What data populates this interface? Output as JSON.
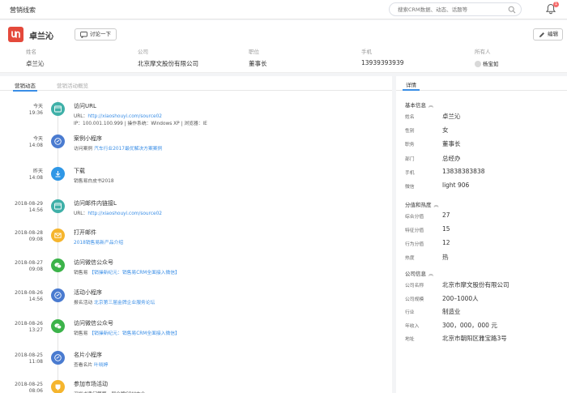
{
  "page_title": "营销线索",
  "search": {
    "placeholder": "搜索CRM数据、动态、话题等"
  },
  "notifications": {
    "count": "1"
  },
  "lead": {
    "name": "卓兰沁",
    "discuss_label": "讨论一下",
    "edit_label": "编辑",
    "fields": [
      {
        "label": "姓名",
        "value": "卓兰沁"
      },
      {
        "label": "公司",
        "value": "北京摩文股份有限公司"
      },
      {
        "label": "职位",
        "value": "董事长"
      },
      {
        "label": "手机",
        "value": "13939393939"
      },
      {
        "label": "所有人",
        "value": "杨宝如"
      }
    ]
  },
  "tabs": [
    {
      "label": "营销动态"
    },
    {
      "label": "营销活动概览"
    }
  ],
  "timeline": [
    {
      "date1": "今天",
      "date2": "19:36",
      "icon": "web-icon",
      "color": "#3fb0a8",
      "title": "访问URL",
      "l1_prefix": "URL：",
      "l1_link": "http://xiaoshouyi.com/source02",
      "l1_suffix": "",
      "l2": "IP：100.001.100.999 | 操作系统：Windows XP | 浏览器：IE"
    },
    {
      "date1": "今天",
      "date2": "14:08",
      "icon": "mini-program-icon",
      "color": "#4a7bd0",
      "title": "案例小程序",
      "l1_prefix": "访问案例 ",
      "l1_link": "汽车行业2017最优解决方案案例",
      "l1_suffix": "",
      "l2": ""
    },
    {
      "date1": "昨天",
      "date2": "14:08",
      "icon": "download-icon",
      "color": "#2f97e6",
      "title": "下载",
      "l1_prefix": "销售易白皮书2018",
      "l1_link": "",
      "l1_suffix": "",
      "l2": ""
    },
    {
      "date1": "2018-08-29",
      "date2": "14:56",
      "icon": "web-icon",
      "color": "#3fb0a8",
      "title": "访问邮件内链接L",
      "l1_prefix": "URL：",
      "l1_link": "http://xiaoshouyi.com/source02",
      "l1_suffix": "",
      "l2": ""
    },
    {
      "date1": "2018-08-28",
      "date2": "09:08",
      "icon": "mail-icon",
      "color": "#f5b52e",
      "title": "打开邮件",
      "l1_prefix": "",
      "l1_link": "2018销售易新产品介绍",
      "l1_suffix": "",
      "l2": ""
    },
    {
      "date1": "2018-08-27",
      "date2": "09:08",
      "icon": "wechat-icon",
      "color": "#3cb34a",
      "title": "访问微信公众号",
      "l1_prefix": "销售易 ",
      "l1_link": "【销操新纪元：销售易CRM全面接入微信】",
      "l1_suffix": "",
      "l2": ""
    },
    {
      "date1": "2018-08-26",
      "date2": "14:56",
      "icon": "mini-program-icon",
      "color": "#4a7bd0",
      "title": "活动小程序",
      "l1_prefix": "报名活动 ",
      "l1_link": "北京第三届金牌企业服务论坛",
      "l1_suffix": "",
      "l2": ""
    },
    {
      "date1": "2018-08-26",
      "date2": "13:27",
      "icon": "wechat-icon",
      "color": "#3cb34a",
      "title": "访问微信公众号",
      "l1_prefix": "销售易 ",
      "l1_link": "【销操新纪元：销售易CRM全面接入微信】",
      "l1_suffix": "",
      "l2": ""
    },
    {
      "date1": "2018-08-25",
      "date2": "11:08",
      "icon": "mini-program-icon",
      "color": "#4a7bd0",
      "title": "名片小程序",
      "l1_prefix": "查看名片 ",
      "l1_link": "叶晓婷",
      "l1_suffix": "",
      "l2": ""
    },
    {
      "date1": "2018-08-25",
      "date2": "08:06",
      "icon": "activity-icon",
      "color": "#f5b52e",
      "title": "参加市场活动",
      "l1_prefix": "深圳书香门第第一届金牌CRM大会",
      "l1_link": "",
      "l1_suffix": "",
      "l2": ""
    }
  ],
  "detail": {
    "tab_label": "详情",
    "sections": [
      {
        "title": "基本信息",
        "rows": [
          {
            "k": "姓名",
            "v": "卓兰沁"
          },
          {
            "k": "性别",
            "v": "女"
          },
          {
            "k": "职务",
            "v": "董事长"
          },
          {
            "k": "部门",
            "v": "总经办"
          },
          {
            "k": "手机",
            "v": "13838383838"
          },
          {
            "k": "微信",
            "v": "light 906"
          }
        ]
      },
      {
        "title": "分值和热度",
        "rows": [
          {
            "k": "综合分值",
            "v": "27"
          },
          {
            "k": "特征分值",
            "v": "15"
          },
          {
            "k": "行为分值",
            "v": "12"
          },
          {
            "k": "热度",
            "v": "热"
          }
        ]
      },
      {
        "title": "公司信息",
        "rows": [
          {
            "k": "公司名称",
            "v": "北京市摩文股份有限公司"
          },
          {
            "k": "公司规模",
            "v": "200–1000人"
          },
          {
            "k": "行业",
            "v": "制造业"
          },
          {
            "k": "年收入",
            "v": "300，000，000 元"
          },
          {
            "k": "地址",
            "v": "北京市朝阳区雅宝路3号"
          }
        ]
      }
    ]
  }
}
